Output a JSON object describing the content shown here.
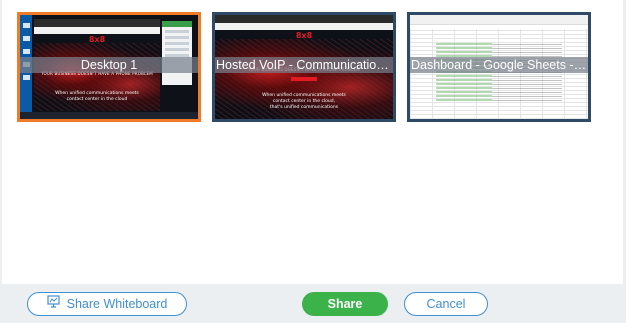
{
  "screens": [
    {
      "caption": "Desktop 1",
      "selected": true
    },
    {
      "caption": "Hosted VoIP - Communications and",
      "selected": false
    },
    {
      "caption": "Dashboard - Google Sheets - Googl",
      "selected": false
    }
  ],
  "footer": {
    "whiteboard_label": "Share Whiteboard",
    "share_label": "Share",
    "cancel_label": "Cancel"
  },
  "colors": {
    "selected_border": "#f07c2a",
    "thumb_border": "#2f4a66",
    "share_green": "#3cb24a",
    "outline_blue": "#3f8fd2",
    "footer_bg": "#eceff2"
  },
  "icons": {
    "whiteboard": "whiteboard-icon"
  }
}
